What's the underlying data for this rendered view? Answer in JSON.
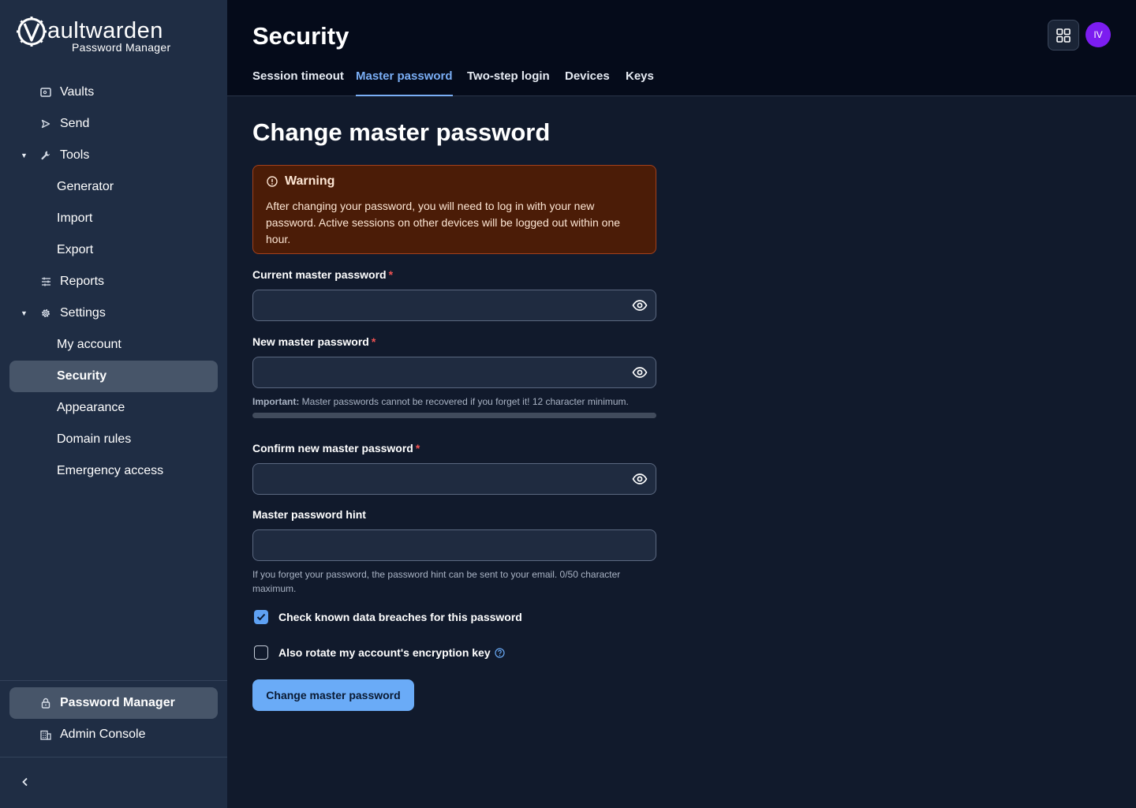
{
  "brand": {
    "name": "Vaultwarden",
    "tagline": "Password Manager"
  },
  "sidebar": {
    "items": [
      {
        "label": "Vaults",
        "icon": "vault-icon"
      },
      {
        "label": "Send",
        "icon": "send-icon"
      },
      {
        "label": "Tools",
        "icon": "wrench-icon",
        "expanded": true
      },
      {
        "label": "Generator"
      },
      {
        "label": "Import"
      },
      {
        "label": "Export"
      },
      {
        "label": "Reports",
        "icon": "sliders-icon"
      },
      {
        "label": "Settings",
        "icon": "gear-icon",
        "expanded": true
      },
      {
        "label": "My account"
      },
      {
        "label": "Security",
        "active": true
      },
      {
        "label": "Appearance"
      },
      {
        "label": "Domain rules"
      },
      {
        "label": "Emergency access"
      }
    ],
    "product_switcher": [
      {
        "label": "Password Manager",
        "icon": "lock-icon",
        "active": true
      },
      {
        "label": "Admin Console",
        "icon": "building-icon"
      }
    ],
    "collapse_icon": "chevron-left-icon"
  },
  "header": {
    "title": "Security",
    "tabs": [
      {
        "label": "Session timeout"
      },
      {
        "label": "Master password",
        "active": true
      },
      {
        "label": "Two-step login"
      },
      {
        "label": "Devices"
      },
      {
        "label": "Keys"
      }
    ],
    "avatar_initials": "IV",
    "apps_icon": "grid-icon"
  },
  "main": {
    "section_title": "Change master password",
    "warning": {
      "title": "Warning",
      "body": "After changing your password, you will need to log in with your new password. Active sessions on other devices will be logged out within one hour."
    },
    "fields": {
      "current": {
        "label": "Current master password",
        "value": ""
      },
      "new": {
        "label": "New master password",
        "value": ""
      },
      "new_hint_strong": "Important:",
      "new_hint": "Master passwords cannot be recovered if you forget it! 12 character minimum.",
      "new_strength": 0,
      "confirm": {
        "label": "Confirm new master password",
        "value": ""
      },
      "hint": {
        "label": "Master password hint",
        "value": ""
      },
      "hint_help": "If you forget your password, the password hint can be sent to your email. 0/50 character maximum."
    },
    "checks": {
      "breach": {
        "label": "Check known data breaches for this password",
        "checked": true
      },
      "rotate": {
        "label": "Also rotate my account's encryption key",
        "checked": false
      }
    },
    "submit_label": "Change master password"
  },
  "colors": {
    "accent": "#7aaef5",
    "primary_button": "#6aabf7",
    "warning_bg": "#4b1c07",
    "active_nav": "#475569",
    "avatar": "#7c1df0"
  }
}
